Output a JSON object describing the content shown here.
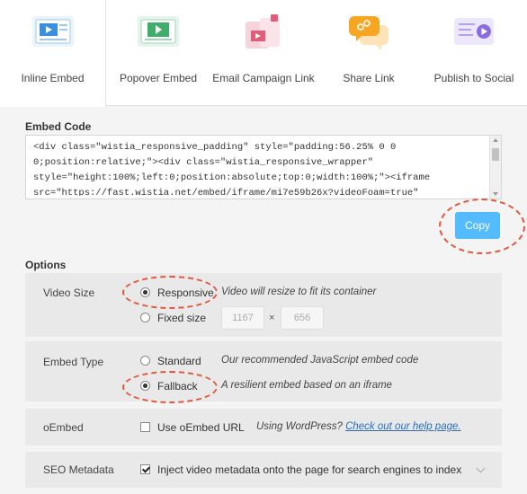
{
  "tabs": [
    {
      "label": "Inline Embed",
      "icon": "inline-embed-icon",
      "active": true
    },
    {
      "label": "Popover Embed",
      "icon": "popover-embed-icon",
      "active": false
    },
    {
      "label": "Email Campaign Link",
      "icon": "email-campaign-icon",
      "active": false
    },
    {
      "label": "Share Link",
      "icon": "share-link-icon",
      "active": false
    },
    {
      "label": "Publish to Social",
      "icon": "publish-social-icon",
      "active": false
    }
  ],
  "embed_code": {
    "title": "Embed Code",
    "lines": [
      "<div class=\"wistia_responsive_padding\" style=\"padding:56.25% 0 0",
      "0;position:relative;\"><div class=\"wistia_responsive_wrapper\"",
      "style=\"height:100%;left:0;position:absolute;top:0;width:100%;\"><iframe",
      "src=\"https://fast.wistia.net/embed/iframe/mi7e59b26x?videoFoam=true\""
    ],
    "copy_label": "Copy"
  },
  "options": {
    "title": "Options",
    "video_size": {
      "label": "Video Size",
      "responsive_label": "Responsive",
      "responsive_desc": "Video will resize to fit its container",
      "fixed_label": "Fixed size",
      "width": "1167",
      "times": "×",
      "height": "656",
      "selected": "responsive"
    },
    "embed_type": {
      "label": "Embed Type",
      "standard_label": "Standard",
      "standard_desc": "Our recommended JavaScript embed code",
      "fallback_label": "Fallback",
      "fallback_desc": "A resilient embed based on an iframe",
      "selected": "fallback"
    },
    "oembed": {
      "label": "oEmbed",
      "checkbox_label": "Use oEmbed URL",
      "desc_prefix": "Using WordPress?",
      "link_text": "Check out our help page.",
      "checked": false
    },
    "seo": {
      "label": "SEO Metadata",
      "checkbox_label": "Inject video metadata onto the page for search engines to index",
      "checked": true
    }
  },
  "colors": {
    "accent": "#54bbff",
    "highlight_ring": "#e2573c",
    "link": "#2a6dbd"
  }
}
